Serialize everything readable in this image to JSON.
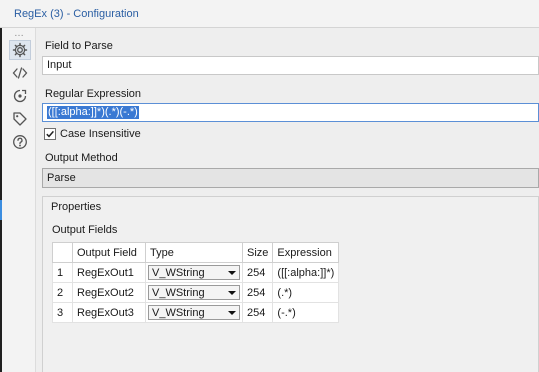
{
  "window": {
    "title": "RegEx (3) - Configuration"
  },
  "toolbar": {
    "dots": "…",
    "items": [
      {
        "icon": "gear-icon",
        "active": true
      },
      {
        "icon": "code-icon",
        "active": false
      },
      {
        "icon": "navigate-icon",
        "active": false
      },
      {
        "icon": "tag-icon",
        "active": false
      },
      {
        "icon": "help-icon",
        "active": false
      }
    ]
  },
  "field_to_parse": {
    "label": "Field to Parse",
    "value": "Input"
  },
  "regular_expression": {
    "label": "Regular Expression",
    "value": "([[:alpha:]]*)(.*)(-.*)"
  },
  "case_insensitive": {
    "label": "Case Insensitive",
    "checked": true
  },
  "output_method": {
    "label": "Output Method",
    "value": "Parse"
  },
  "properties": {
    "label": "Properties",
    "output_fields_label": "Output Fields",
    "columns": [
      "",
      "Output Field",
      "Type",
      "Size",
      "Expression"
    ],
    "rows": [
      {
        "num": "1",
        "field": "RegExOut1",
        "type": "V_WString",
        "size": "254",
        "expression": "([[:alpha:]]*)"
      },
      {
        "num": "2",
        "field": "RegExOut2",
        "type": "V_WString",
        "size": "254",
        "expression": "(.*)"
      },
      {
        "num": "3",
        "field": "RegExOut3",
        "type": "V_WString",
        "size": "254",
        "expression": "(-.*)"
      }
    ]
  }
}
